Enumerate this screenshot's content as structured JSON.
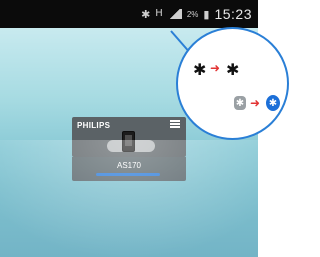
{
  "status_bar": {
    "time": "15:23",
    "network_label": "H",
    "battery_text": "2%",
    "icons": [
      "bluetooth-icon",
      "signal-icon",
      "battery-icon"
    ]
  },
  "widget": {
    "brand": "PHILIPS",
    "model": "AS170",
    "progress_fraction": 1.0
  },
  "callout": {
    "row1": [
      "bluetooth-icon",
      "arrow-right-icon",
      "bluetooth-connecting-icon"
    ],
    "row2": [
      "bluetooth-gray-icon",
      "arrow-right-icon",
      "bluetooth-blue-icon"
    ],
    "colors": {
      "accent": "#2a7fd6",
      "arrow": "#e23333"
    }
  }
}
